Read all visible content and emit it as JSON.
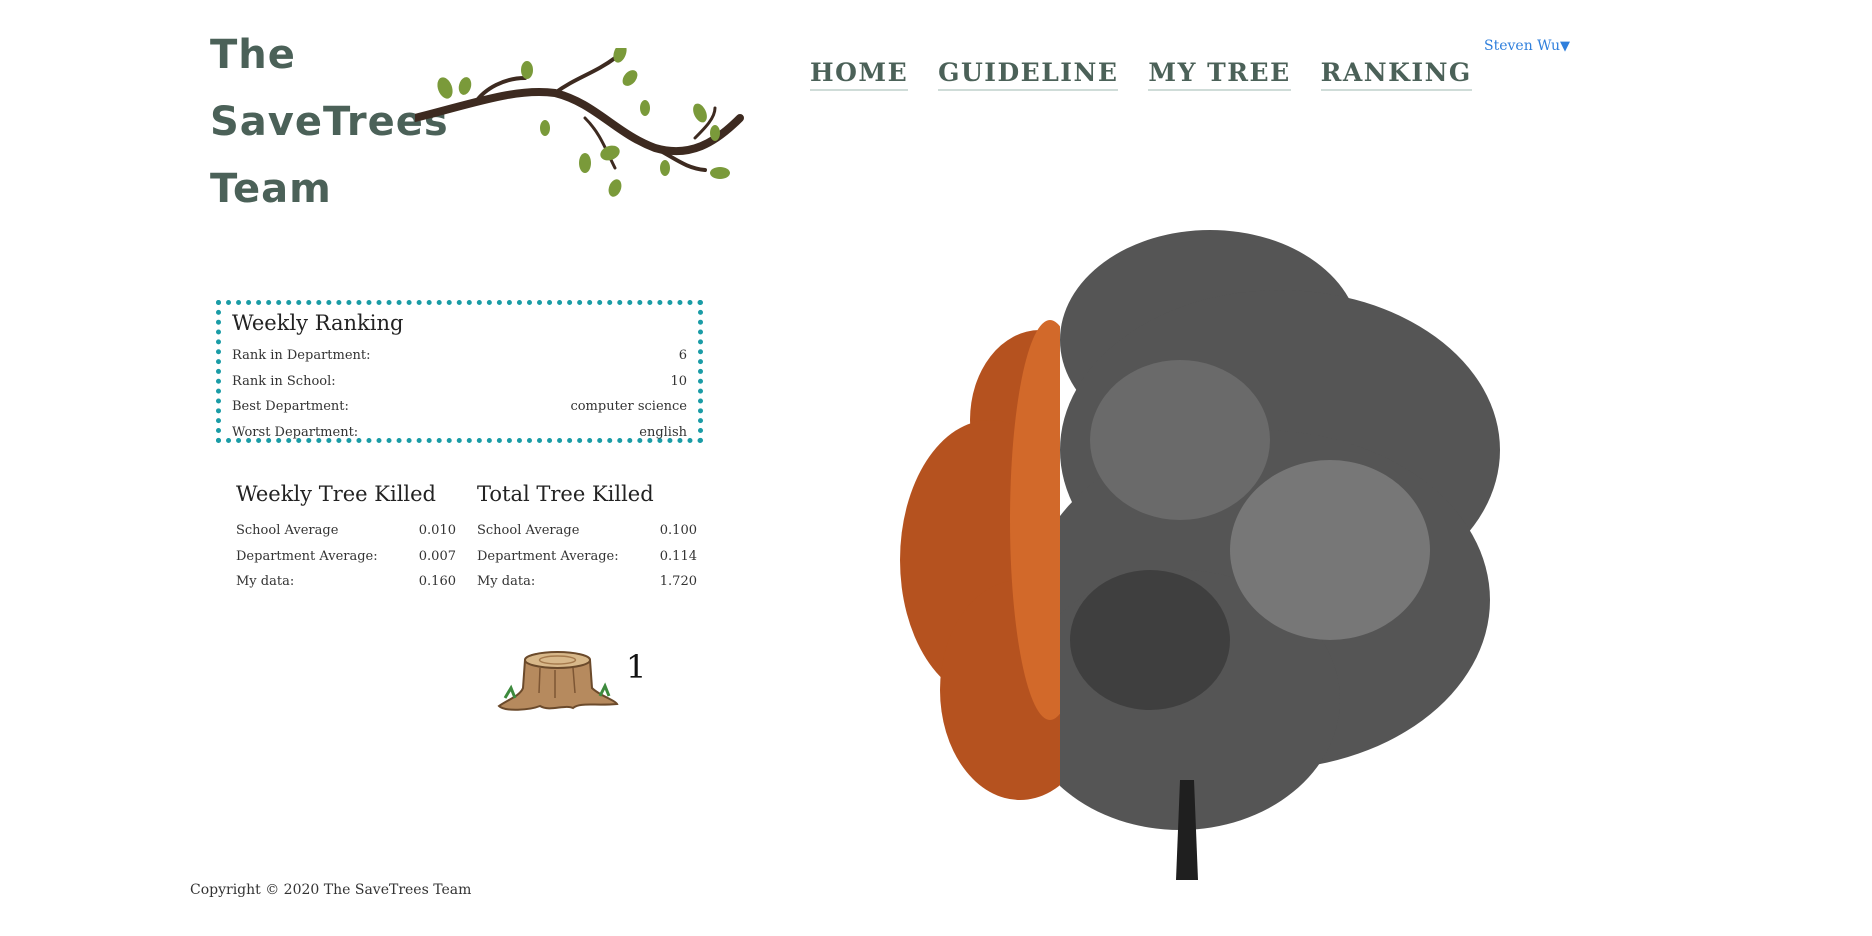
{
  "logo": {
    "line1": "The",
    "line2": "SaveTrees",
    "line3": "Team"
  },
  "nav": {
    "home": "HOME",
    "guideline": "GUIDELINE",
    "my_tree": "MY TREE",
    "ranking": "RANKING"
  },
  "user": {
    "name": "Steven Wu",
    "arrow": "▼"
  },
  "weekly_ranking": {
    "title": "Weekly Ranking",
    "rows": [
      {
        "label": "Rank in Department:",
        "value": "6"
      },
      {
        "label": "Rank in School:",
        "value": "10"
      },
      {
        "label": "Best Department:",
        "value": "computer science"
      },
      {
        "label": "Worst Department:",
        "value": "english"
      }
    ]
  },
  "weekly_killed": {
    "title": "Weekly Tree Killed",
    "rows": [
      {
        "label": "School Average",
        "value": "0.010"
      },
      {
        "label": "Department Average:",
        "value": "0.007"
      },
      {
        "label": "My data:",
        "value": "0.160"
      }
    ]
  },
  "total_killed": {
    "title": "Total Tree Killed",
    "rows": [
      {
        "label": "School Average",
        "value": "0.100"
      },
      {
        "label": "Department Average:",
        "value": "0.114"
      },
      {
        "label": "My data:",
        "value": "1.720"
      }
    ]
  },
  "stump": {
    "count": "1",
    "icon": "tree-stump-icon"
  },
  "tree_image": {
    "icon": "half-colored-tree-illustration"
  },
  "colors": {
    "brand": "#4b6158",
    "accent": "#1a9ca6",
    "link": "#2f7fdc"
  },
  "footer": {
    "copyright": "Copyright © 2020 The SaveTrees Team"
  }
}
